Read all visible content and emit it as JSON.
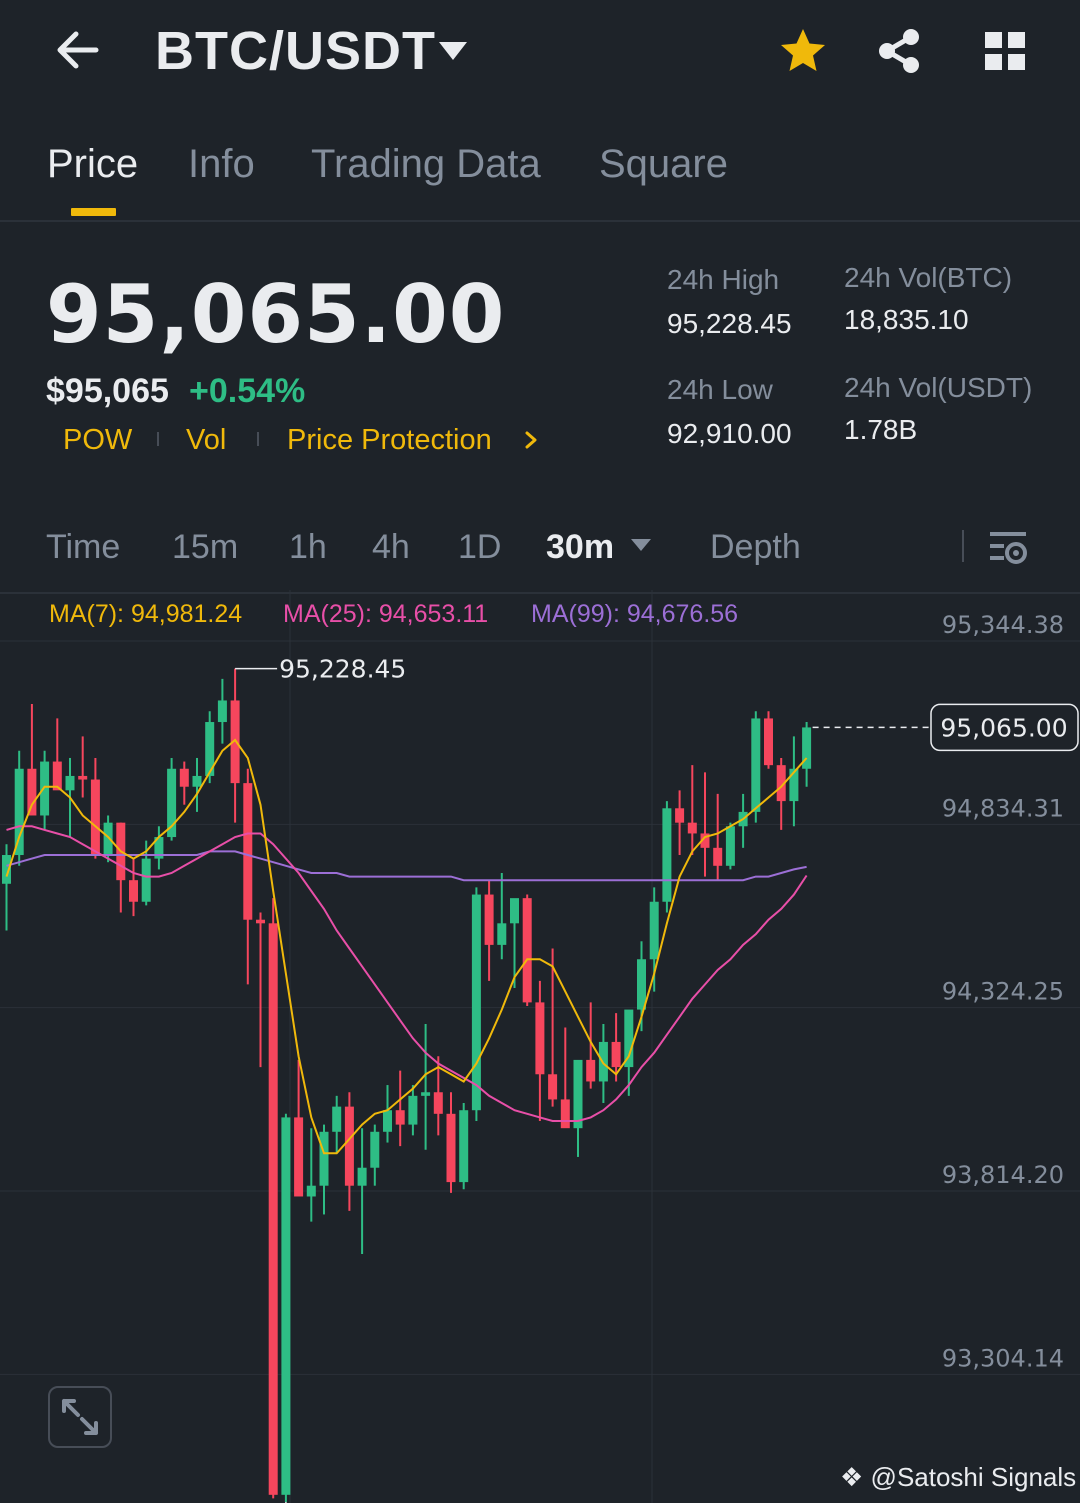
{
  "header": {
    "pair": "BTC/USDT",
    "icons": {
      "back": "arrow-left-icon",
      "dropdown": "caret-down-icon",
      "favorite": "star-icon",
      "share": "share-icon",
      "menu": "grid-icon"
    },
    "favorite_color": "#f0b90b"
  },
  "tabs": [
    {
      "label": "Price",
      "active": true
    },
    {
      "label": "Info",
      "active": false
    },
    {
      "label": "Trading Data",
      "active": false
    },
    {
      "label": "Square",
      "active": false
    }
  ],
  "ticker": {
    "last_price": "95,065.00",
    "usd_price": "$95,065",
    "change_pct": "+0.54%",
    "tags": [
      "POW",
      "Vol",
      "Price Protection"
    ],
    "stats": {
      "high_label": "24h High",
      "high_value": "95,228.45",
      "low_label": "24h Low",
      "low_value": "92,910.00",
      "vol_btc_label": "24h Vol(BTC)",
      "vol_btc_value": "18,835.10",
      "vol_usdt_label": "24h Vol(USDT)",
      "vol_usdt_value": "1.78B"
    }
  },
  "intervals": [
    {
      "label": "Time",
      "active": false
    },
    {
      "label": "15m",
      "active": false
    },
    {
      "label": "1h",
      "active": false
    },
    {
      "label": "4h",
      "active": false
    },
    {
      "label": "1D",
      "active": false
    },
    {
      "label": "30m",
      "active": true
    },
    {
      "label": "Depth",
      "active": false
    }
  ],
  "ma_legend": [
    {
      "label": "MA(7): 94,981.24",
      "color": "#f0b90b"
    },
    {
      "label": "MA(25): 94,653.11",
      "color": "#e84fa8"
    },
    {
      "label": "MA(99): 94,676.56",
      "color": "#9c6fd6"
    }
  ],
  "watermark": "@Satoshi Signals",
  "colors": {
    "up": "#2ebd85",
    "down": "#f6465d",
    "accent": "#f0b90b",
    "bg": "#1e2329"
  },
  "chart_data": {
    "type": "candlestick",
    "ylim": [
      92910,
      95344.38
    ],
    "y_ticks": [
      "95,344.38",
      "94,834.31",
      "94,324.25",
      "93,814.20",
      "93,304.14"
    ],
    "y_tick_values": [
      95344.38,
      94834.31,
      94324.25,
      93814.2,
      93304.14
    ],
    "last_price_label": "95,065.00",
    "last_price": 95065,
    "high_label": "95,228.45",
    "low_label": "92,910.00",
    "candles": [
      {
        "o": 94630,
        "h": 94740,
        "l": 94500,
        "c": 94710
      },
      {
        "o": 94710,
        "h": 95000,
        "l": 94680,
        "c": 94950
      },
      {
        "o": 94950,
        "h": 95130,
        "l": 94850,
        "c": 94820
      },
      {
        "o": 94820,
        "h": 95000,
        "l": 94780,
        "c": 94970
      },
      {
        "o": 94970,
        "h": 95090,
        "l": 94900,
        "c": 94890
      },
      {
        "o": 94890,
        "h": 94980,
        "l": 94760,
        "c": 94930
      },
      {
        "o": 94930,
        "h": 95040,
        "l": 94870,
        "c": 94920
      },
      {
        "o": 94920,
        "h": 94980,
        "l": 94700,
        "c": 94710
      },
      {
        "o": 94710,
        "h": 94820,
        "l": 94690,
        "c": 94800
      },
      {
        "o": 94800,
        "h": 94800,
        "l": 94550,
        "c": 94640
      },
      {
        "o": 94640,
        "h": 94700,
        "l": 94540,
        "c": 94580
      },
      {
        "o": 94580,
        "h": 94750,
        "l": 94570,
        "c": 94700
      },
      {
        "o": 94700,
        "h": 94790,
        "l": 94670,
        "c": 94760
      },
      {
        "o": 94760,
        "h": 94980,
        "l": 94750,
        "c": 94950
      },
      {
        "o": 94950,
        "h": 94970,
        "l": 94850,
        "c": 94900
      },
      {
        "o": 94900,
        "h": 94980,
        "l": 94830,
        "c": 94930
      },
      {
        "o": 94930,
        "h": 95110,
        "l": 94910,
        "c": 95080
      },
      {
        "o": 95080,
        "h": 95200,
        "l": 95020,
        "c": 95140
      },
      {
        "o": 95140,
        "h": 95228.45,
        "l": 94800,
        "c": 94910
      },
      {
        "o": 94910,
        "h": 94950,
        "l": 94350,
        "c": 94530
      },
      {
        "o": 94530,
        "h": 94550,
        "l": 94120,
        "c": 94520
      },
      {
        "o": 94520,
        "h": 94590,
        "l": 92920,
        "c": 92930
      },
      {
        "o": 92930,
        "h": 93990,
        "l": 92910,
        "c": 93980
      },
      {
        "o": 93980,
        "h": 94140,
        "l": 93860,
        "c": 93760
      },
      {
        "o": 93760,
        "h": 93950,
        "l": 93690,
        "c": 93790
      },
      {
        "o": 93790,
        "h": 93960,
        "l": 93710,
        "c": 93940
      },
      {
        "o": 93940,
        "h": 94040,
        "l": 93880,
        "c": 94010
      },
      {
        "o": 94010,
        "h": 94050,
        "l": 93720,
        "c": 93790
      },
      {
        "o": 93790,
        "h": 93950,
        "l": 93600,
        "c": 93840
      },
      {
        "o": 93840,
        "h": 93960,
        "l": 93790,
        "c": 93940
      },
      {
        "o": 93940,
        "h": 94070,
        "l": 93910,
        "c": 94000
      },
      {
        "o": 94000,
        "h": 94110,
        "l": 93900,
        "c": 93960
      },
      {
        "o": 93960,
        "h": 94070,
        "l": 93930,
        "c": 94040
      },
      {
        "o": 94040,
        "h": 94240,
        "l": 93890,
        "c": 94050
      },
      {
        "o": 94050,
        "h": 94150,
        "l": 93930,
        "c": 93990
      },
      {
        "o": 93990,
        "h": 94050,
        "l": 93770,
        "c": 93800
      },
      {
        "o": 93800,
        "h": 94020,
        "l": 93780,
        "c": 94000
      },
      {
        "o": 94000,
        "h": 94620,
        "l": 93970,
        "c": 94600
      },
      {
        "o": 94600,
        "h": 94640,
        "l": 94360,
        "c": 94460
      },
      {
        "o": 94460,
        "h": 94660,
        "l": 94420,
        "c": 94520
      },
      {
        "o": 94520,
        "h": 94560,
        "l": 94340,
        "c": 94590
      },
      {
        "o": 94590,
        "h": 94600,
        "l": 94290,
        "c": 94300
      },
      {
        "o": 94300,
        "h": 94360,
        "l": 93970,
        "c": 94100
      },
      {
        "o": 94100,
        "h": 94450,
        "l": 94010,
        "c": 94030
      },
      {
        "o": 94030,
        "h": 94230,
        "l": 93980,
        "c": 93950
      },
      {
        "o": 93950,
        "h": 94130,
        "l": 93870,
        "c": 94140
      },
      {
        "o": 94140,
        "h": 94300,
        "l": 94060,
        "c": 94080
      },
      {
        "o": 94080,
        "h": 94240,
        "l": 94020,
        "c": 94190
      },
      {
        "o": 94190,
        "h": 94270,
        "l": 94080,
        "c": 94120
      },
      {
        "o": 94120,
        "h": 94240,
        "l": 94040,
        "c": 94280
      },
      {
        "o": 94280,
        "h": 94470,
        "l": 94220,
        "c": 94420
      },
      {
        "o": 94420,
        "h": 94620,
        "l": 94330,
        "c": 94580
      },
      {
        "o": 94580,
        "h": 94860,
        "l": 94550,
        "c": 94840
      },
      {
        "o": 94840,
        "h": 94890,
        "l": 94710,
        "c": 94800
      },
      {
        "o": 94800,
        "h": 94960,
        "l": 94710,
        "c": 94770
      },
      {
        "o": 94770,
        "h": 94940,
        "l": 94650,
        "c": 94730
      },
      {
        "o": 94730,
        "h": 94880,
        "l": 94640,
        "c": 94680
      },
      {
        "o": 94680,
        "h": 94800,
        "l": 94670,
        "c": 94790
      },
      {
        "o": 94790,
        "h": 94880,
        "l": 94730,
        "c": 94830
      },
      {
        "o": 94830,
        "h": 95110,
        "l": 94800,
        "c": 95090
      },
      {
        "o": 95090,
        "h": 95110,
        "l": 94950,
        "c": 94960
      },
      {
        "o": 94960,
        "h": 94980,
        "l": 94780,
        "c": 94860
      },
      {
        "o": 94860,
        "h": 95040,
        "l": 94790,
        "c": 94950
      },
      {
        "o": 94950,
        "h": 95080,
        "l": 94900,
        "c": 95065
      }
    ],
    "ma7": [
      94650,
      94760,
      94850,
      94900,
      94900,
      94870,
      94820,
      94790,
      94760,
      94720,
      94700,
      94720,
      94760,
      94790,
      94830,
      94880,
      94940,
      95000,
      95030,
      94980,
      94850,
      94610,
      94380,
      94150,
      93980,
      93880,
      93880,
      93920,
      93960,
      93990,
      94000,
      94030,
      94060,
      94100,
      94120,
      94100,
      94080,
      94130,
      94200,
      94280,
      94370,
      94420,
      94420,
      94400,
      94330,
      94260,
      94190,
      94130,
      94100,
      94150,
      94260,
      94380,
      94520,
      94650,
      94720,
      94760,
      94770,
      94790,
      94810,
      94840,
      94870,
      94900,
      94940,
      94980
    ],
    "ma25": [
      94780,
      94790,
      94790,
      94780,
      94770,
      94760,
      94740,
      94720,
      94700,
      94680,
      94660,
      94650,
      94650,
      94660,
      94680,
      94700,
      94720,
      94740,
      94760,
      94770,
      94770,
      94740,
      94700,
      94660,
      94610,
      94560,
      94500,
      94450,
      94400,
      94350,
      94300,
      94250,
      94200,
      94160,
      94130,
      94110,
      94090,
      94070,
      94040,
      94020,
      94000,
      93990,
      93980,
      93970,
      93970,
      93970,
      93980,
      94000,
      94030,
      94070,
      94120,
      94160,
      94210,
      94260,
      94310,
      94350,
      94390,
      94420,
      94460,
      94490,
      94530,
      94560,
      94600,
      94653
    ],
    "ma99": [
      94680,
      94690,
      94700,
      94710,
      94710,
      94710,
      94710,
      94710,
      94710,
      94710,
      94710,
      94710,
      94710,
      94710,
      94710,
      94710,
      94720,
      94720,
      94720,
      94710,
      94700,
      94690,
      94680,
      94670,
      94660,
      94660,
      94660,
      94650,
      94650,
      94650,
      94650,
      94650,
      94650,
      94650,
      94650,
      94650,
      94640,
      94640,
      94640,
      94640,
      94640,
      94640,
      94640,
      94640,
      94640,
      94640,
      94640,
      94640,
      94640,
      94640,
      94640,
      94640,
      94640,
      94640,
      94640,
      94640,
      94640,
      94640,
      94640,
      94650,
      94650,
      94660,
      94670,
      94677
    ]
  }
}
